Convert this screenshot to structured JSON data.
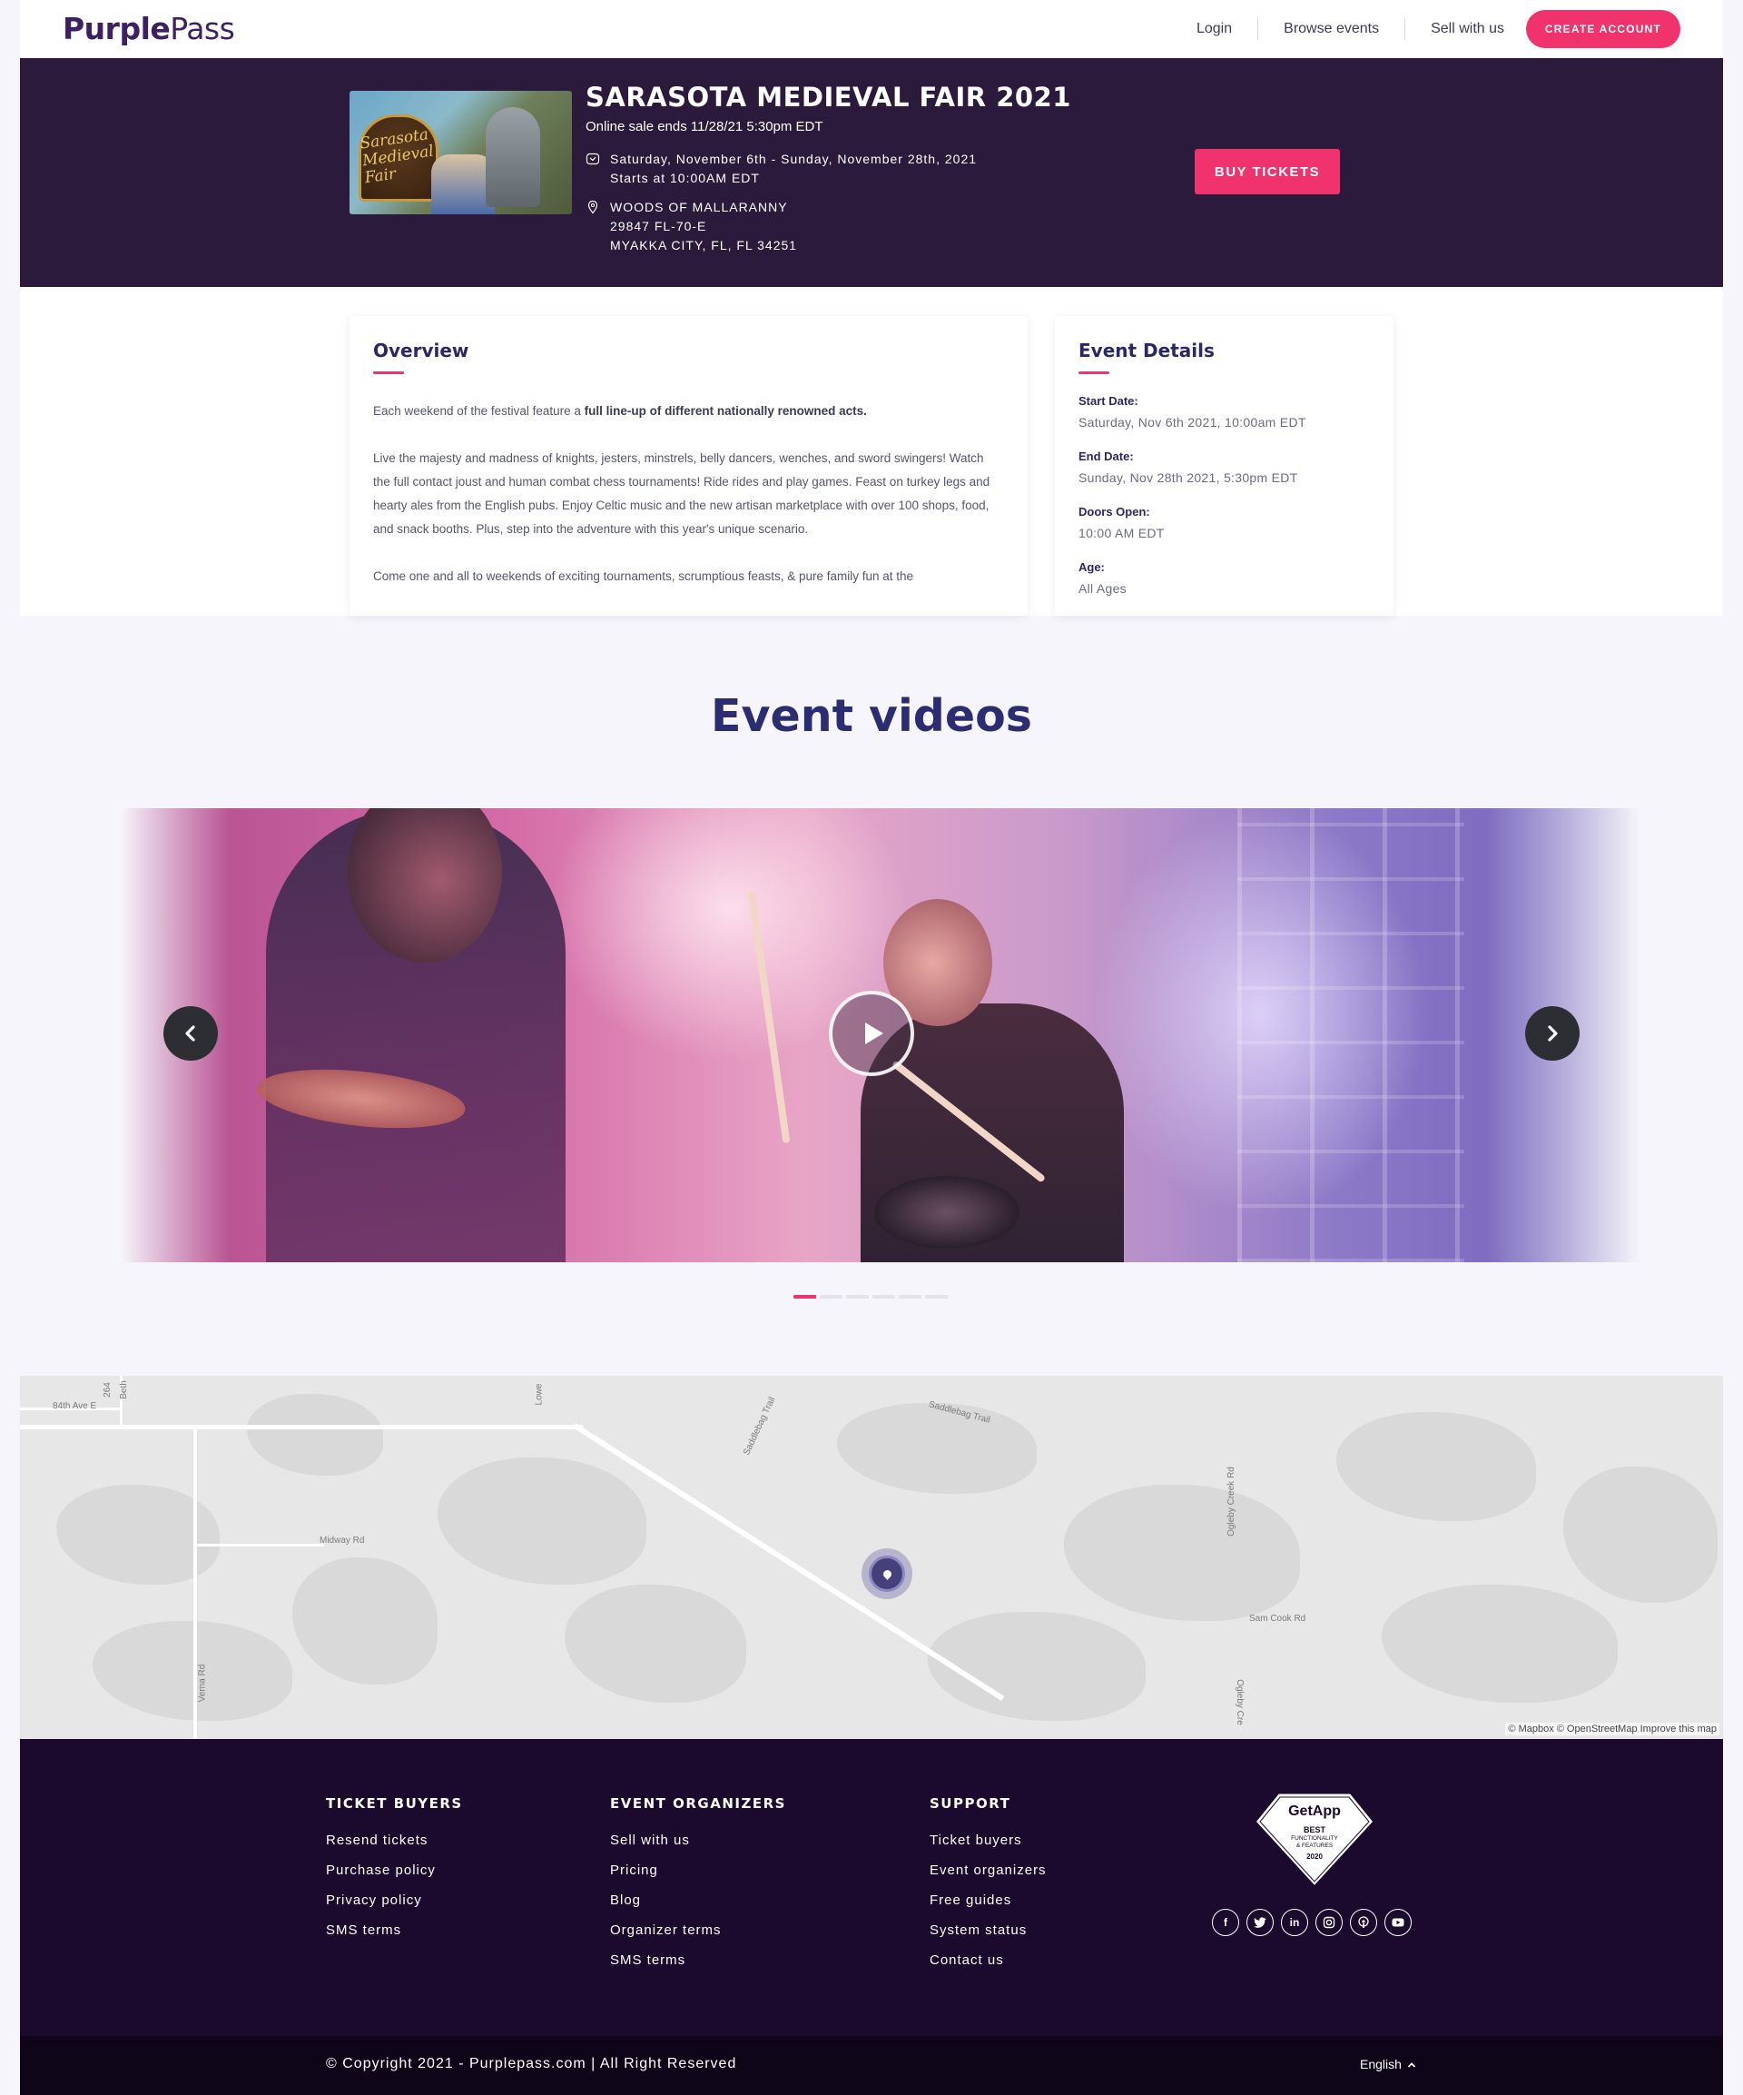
{
  "header": {
    "logo_bold": "Purple",
    "logo_regular": "Pass",
    "nav": [
      "Login",
      "Browse events",
      "Sell with us"
    ],
    "create_account": "CREATE ACCOUNT"
  },
  "event": {
    "title": "SARASOTA MEDIEVAL FAIR 2021",
    "sale_ends": "Online sale ends 11/28/21 5:30pm EDT",
    "dates": "Saturday, November 6th - Sunday, November 28th, 2021",
    "start_time": "Starts at 10:00AM EDT",
    "venue": "WOODS OF MALLARANNY",
    "address1": "29847 FL-70-E",
    "address2": "MYAKKA CITY, FL, FL 34251",
    "buy_tickets": "BUY TICKETS",
    "image_text": "Sarasota Medieval Fair"
  },
  "overview": {
    "heading": "Overview",
    "p1_prefix": "Each weekend of the festival feature a ",
    "p1_bold": "full line-up of different nationally renowned acts.",
    "p2": "Live the majesty and madness of knights, jesters, minstrels, belly dancers, wenches, and sword swingers! Watch the full contact joust and human combat chess tournaments! Ride rides and play games. Feast on turkey legs and hearty ales from the English pubs. Enjoy Celtic music and the new artisan marketplace with over 100 shops, food, and snack booths. Plus, step into the adventure with this year's unique scenario.",
    "p3": "Come one and all to weekends of exciting tournaments, scrumptious feasts, & pure family fun at the"
  },
  "details": {
    "heading": "Event Details",
    "start_label": "Start Date:",
    "start_value": "Saturday, Nov 6th 2021, 10:00am EDT",
    "end_label": "End Date:",
    "end_value": "Sunday, Nov 28th 2021, 5:30pm EDT",
    "doors_label": "Doors Open:",
    "doors_value": "10:00 AM EDT",
    "age_label": "Age:",
    "age_value": "All Ages"
  },
  "videos": {
    "heading": "Event videos",
    "slide_count": 6,
    "active_slide": 1
  },
  "map": {
    "labels": [
      "84th Ave E",
      "264",
      "Beth",
      "Lowe",
      "Saddlebag Trail",
      "Saddlebag Trail",
      "Midway Rd",
      "Verna Rd",
      "Ogleby Creek Rd",
      "Sam Cook Rd",
      "Ogleby Cre"
    ],
    "attribution": "© Mapbox © OpenStreetMap Improve this map"
  },
  "footer": {
    "columns": [
      {
        "title": "TICKET BUYERS",
        "links": [
          "Resend tickets",
          "Purchase policy",
          "Privacy policy",
          "SMS terms"
        ]
      },
      {
        "title": "EVENT ORGANIZERS",
        "links": [
          "Sell with us",
          "Pricing",
          "Blog",
          "Organizer terms",
          "SMS terms"
        ]
      },
      {
        "title": "SUPPORT",
        "links": [
          "Ticket buyers",
          "Event organizers",
          "Free guides",
          "System status",
          "Contact us"
        ]
      }
    ],
    "badge": {
      "brand": "GetApp",
      "line1": "BEST",
      "line2": "FUNCTIONALITY",
      "line3": "& FEATURES",
      "year": "2020"
    },
    "socials": [
      "facebook-icon",
      "twitter-icon",
      "linkedin-icon",
      "instagram-icon",
      "podcast-icon",
      "youtube-icon"
    ],
    "copyright": "© Copyright 2021 - Purplepass.com | All Right Reserved",
    "language": "English"
  },
  "colors": {
    "accent": "#f0326d",
    "hero_bg": "#2c1a3c",
    "footer_bg": "#1b0a2d",
    "heading": "#2b2766"
  }
}
